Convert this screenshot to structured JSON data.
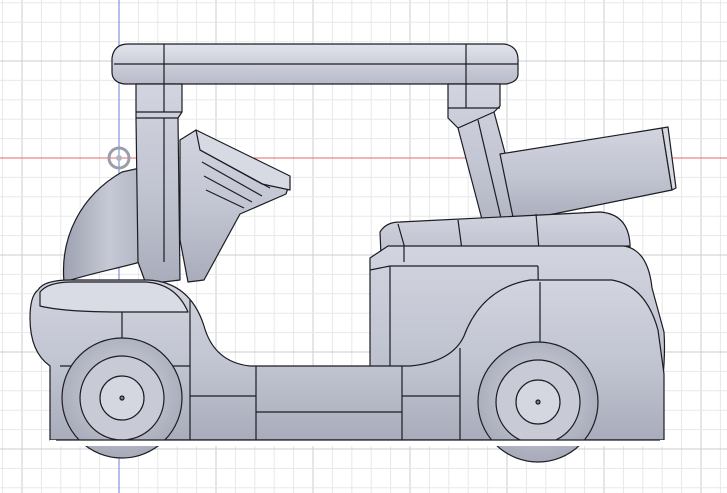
{
  "viewport": {
    "background": "#ffffff",
    "grid_minor_color": "#e6e8ec",
    "grid_major_color": "#c9ccd2",
    "axis_x_color": "#e86a6a",
    "axis_y_color": "#6e7fd6"
  },
  "model": {
    "body_color": "#c2c5d2",
    "body_shadow": "#a8acba",
    "body_light": "#e3e5ee",
    "edge_color": "#1c1c22"
  },
  "origin_marker": {
    "icon": "origin-point-icon",
    "color": "#9a9ea8"
  }
}
